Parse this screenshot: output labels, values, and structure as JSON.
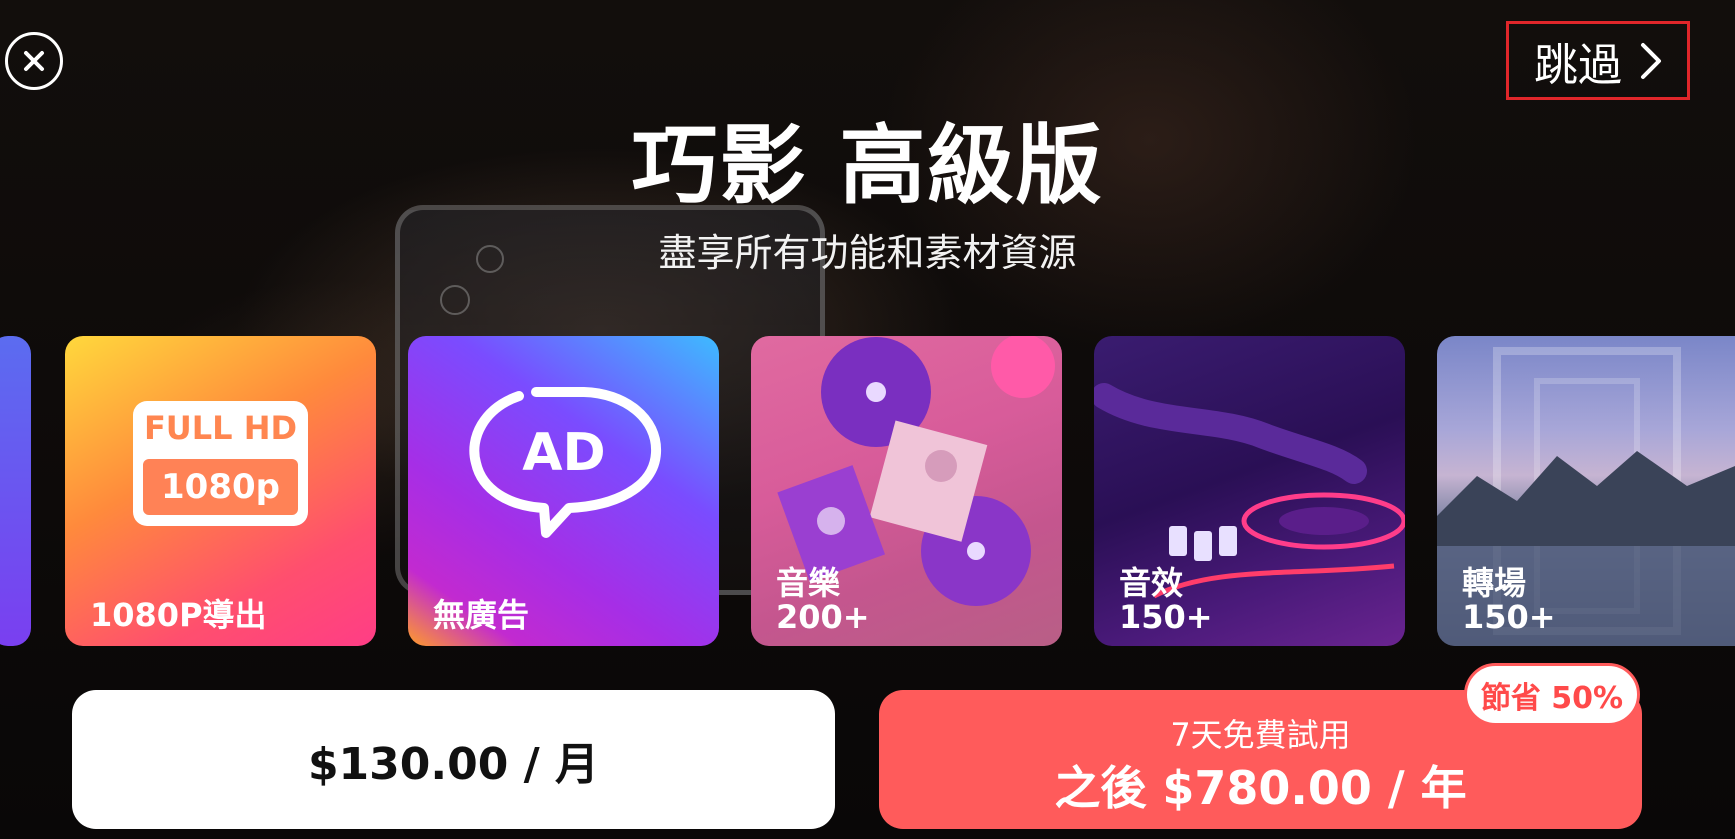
{
  "header": {
    "close_icon": "close-x-icon",
    "skip_label": "跳過",
    "skip_icon": "chevron-right-icon",
    "title": "巧影 高級版",
    "subtitle": "盡享所有功能和素材資源"
  },
  "features": [
    {
      "label": "1080P導出",
      "badge_top": "FULL HD",
      "badge_bottom": "1080p",
      "icon": "full-hd-1080p-icon"
    },
    {
      "label": "無廣告",
      "icon_text": "AD",
      "icon": "no-ads-icon"
    },
    {
      "label": "音樂",
      "count": "200+",
      "image": "vinyl-records"
    },
    {
      "label": "音效",
      "count": "150+",
      "image": "dj-turntable"
    },
    {
      "label": "轉場",
      "count": "150+",
      "image": "mountain-lake"
    }
  ],
  "plans": {
    "monthly": {
      "price_label": "$130.00 / 月"
    },
    "yearly": {
      "trial_label": "7天免費試用",
      "price_label": "之後 $780.00 / 年",
      "badge": "節省 50%"
    }
  },
  "colors": {
    "accent_red": "#ff5b5b",
    "highlight_border": "#e0262a",
    "background": "#0b0908"
  }
}
